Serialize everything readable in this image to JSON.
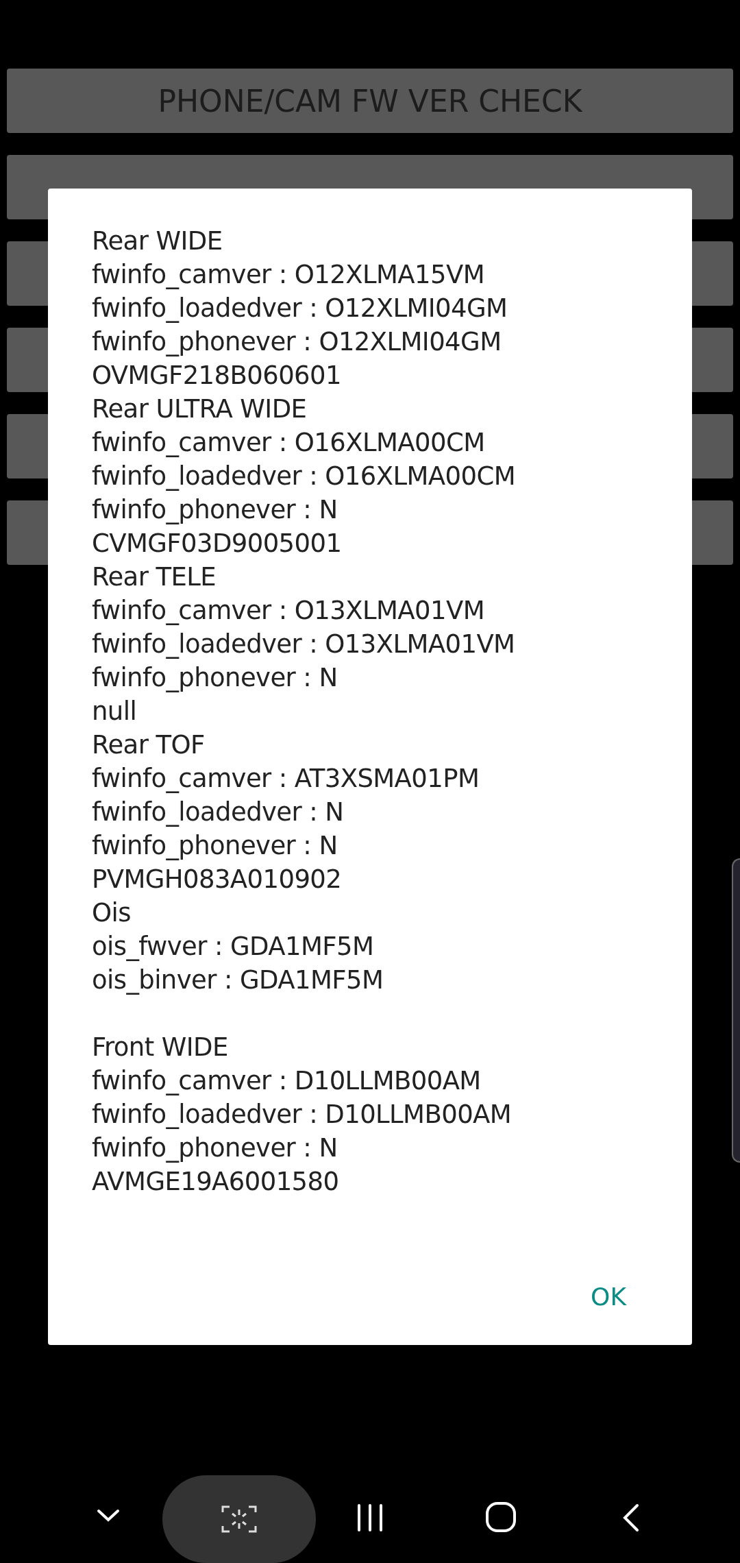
{
  "buttons": [
    {
      "kind": "labeled",
      "label": "PHONE/CAM FW VER CHECK"
    },
    {
      "kind": "covered"
    },
    {
      "kind": "covered"
    },
    {
      "kind": "covered"
    },
    {
      "kind": "covered"
    },
    {
      "kind": "covered"
    }
  ],
  "dialog": {
    "blocks": [
      {
        "lines": [
          "Rear WIDE",
          "fwinfo_camver : O12XLMA15VM",
          "fwinfo_loadedver : O12XLMI04GM",
          "fwinfo_phonever : O12XLMI04GM",
          "OVMGF218B060601",
          "Rear ULTRA WIDE",
          "fwinfo_camver : O16XLMA00CM",
          "fwinfo_loadedver : O16XLMA00CM",
          "fwinfo_phonever : N",
          "CVMGF03D9005001",
          "Rear TELE",
          "fwinfo_camver : O13XLMA01VM",
          "fwinfo_loadedver : O13XLMA01VM",
          "fwinfo_phonever : N",
          "null",
          "Rear TOF",
          "fwinfo_camver : AT3XSMA01PM",
          "fwinfo_loadedver : N",
          "fwinfo_phonever : N",
          "PVMGH083A010902",
          "Ois",
          "ois_fwver : GDA1MF5M",
          "ois_binver : GDA1MF5M"
        ]
      },
      {
        "lines": [
          "Front WIDE",
          "fwinfo_camver : D10LLMB00AM",
          "fwinfo_loadedver : D10LLMB00AM",
          "fwinfo_phonever : N",
          "AVMGE19A6001580"
        ]
      }
    ],
    "ok_button": "OK"
  }
}
